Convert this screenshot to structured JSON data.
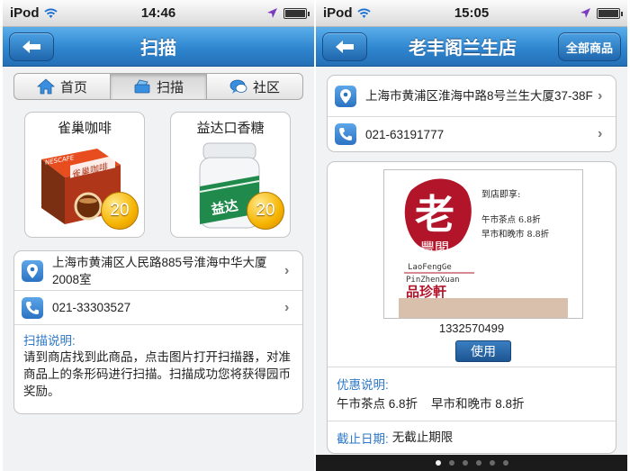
{
  "left": {
    "status": {
      "carrier": "iPod",
      "time": "14:46"
    },
    "nav": {
      "title": "扫描"
    },
    "tabs": [
      {
        "label": "首页",
        "icon": "home-icon"
      },
      {
        "label": "扫描",
        "icon": "scan-icon"
      },
      {
        "label": "社区",
        "icon": "chat-icon"
      }
    ],
    "active_tab": 1,
    "products": [
      {
        "name": "雀巢咖啡",
        "coins": "20",
        "box_text": "雀巢咖啡",
        "brand": "NESCAFE"
      },
      {
        "name": "益达口香糖",
        "coins": "20",
        "box_text": "益达"
      }
    ],
    "address": "上海市黄浦区人民路885号淮海中华大厦2008室",
    "phone": "021-33303527",
    "instructions_label": "扫描说明:",
    "instructions": "请到商店找到此商品，点击图片打开扫描器，对准商品上的条形码进行扫描。扫描成功您将获得园币奖励。"
  },
  "right": {
    "status": {
      "carrier": "iPod",
      "time": "15:05"
    },
    "nav": {
      "title": "老丰阁兰生店",
      "right_button": "全部商品"
    },
    "address": "上海市黄浦区淮海中路8号兰生大厦37-38F",
    "phone": "021-63191777",
    "coupon": {
      "logo_char": "老",
      "logo_sub": "豐閣",
      "logo_en_top": "LaoFengGe",
      "logo_en_bottom": "PinZhenXuan",
      "logo_bottom": "品珍軒",
      "offer_title": "到店即享:",
      "offer_line1": "午市茶点 6.8折",
      "offer_line2": "早市和晚市 8.8折",
      "code": "1332570499",
      "use_label": "使用"
    },
    "discount_label": "优惠说明:",
    "discount_text": "午市茶点 6.8折    早市和晚市 8.8折",
    "deadline_label": "截止日期:",
    "deadline_value": "无截止期限",
    "pages": 6,
    "current_page": 0
  },
  "colors": {
    "nav_blue": "#2f86cf",
    "link_blue": "#2d78c8",
    "coin_gold": "#f5b400",
    "logo_red": "#b2142a"
  }
}
